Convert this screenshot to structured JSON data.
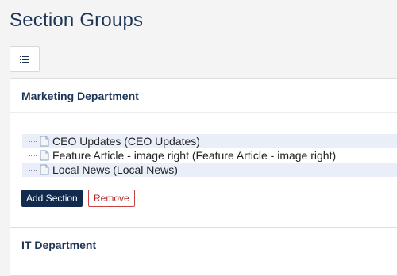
{
  "page": {
    "title": "Section Groups"
  },
  "toolbar": {
    "view_icon": "list-icon"
  },
  "groups": [
    {
      "name": "Marketing Department",
      "sections": [
        {
          "label": "CEO Updates (CEO Updates)",
          "icon": "document-icon"
        },
        {
          "label": "Feature Article - image right (Feature Article - image right)",
          "icon": "document-icon"
        },
        {
          "label": "Local News (Local News)",
          "icon": "document-icon"
        }
      ],
      "add_label": "Add Section",
      "remove_label": "Remove"
    },
    {
      "name": "IT Department"
    }
  ]
}
